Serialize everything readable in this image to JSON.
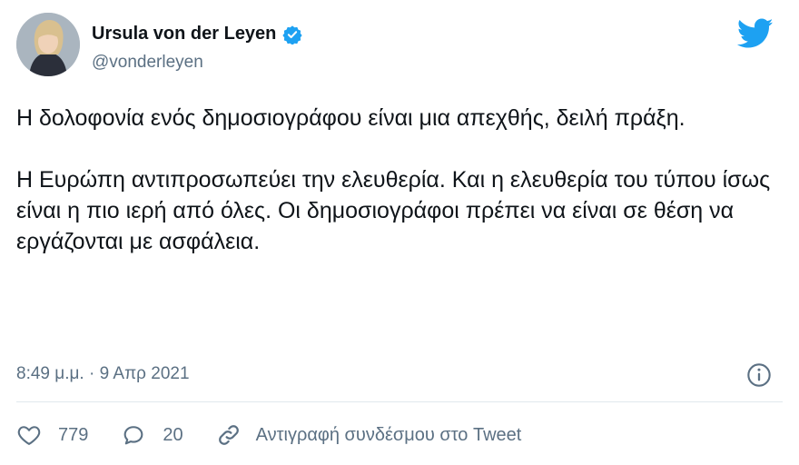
{
  "author": {
    "name": "Ursula von der Leyen",
    "handle": "@vonderleyen"
  },
  "tweet": {
    "paragraphs": [
      "Η δολοφονία ενός δημοσιογράφου είναι μια απεχθής, δειλή πράξη.",
      "Η Ευρώπη αντιπροσωπεύει την ελευθερία. Και η ελευθερία του τύπου ίσως είναι η πιο ιερή από όλες. Οι δημοσιογράφοι πρέπει να είναι σε θέση να εργάζονται με ασφάλεια."
    ],
    "timestamp": "8:49 μ.μ. · 9 Απρ 2021"
  },
  "actions": {
    "likes": "779",
    "replies": "20",
    "copy_link": "Αντιγραφή συνδέσμου στο Tweet"
  },
  "icons": {
    "brand": "twitter-bird-icon",
    "verified": "verified-badge-icon",
    "info": "info-icon",
    "like": "heart-icon",
    "reply": "reply-bubble-icon",
    "link": "link-icon"
  },
  "colors": {
    "brand_blue": "#1da1f2",
    "text": "#0f1419",
    "muted": "#5b7083"
  }
}
